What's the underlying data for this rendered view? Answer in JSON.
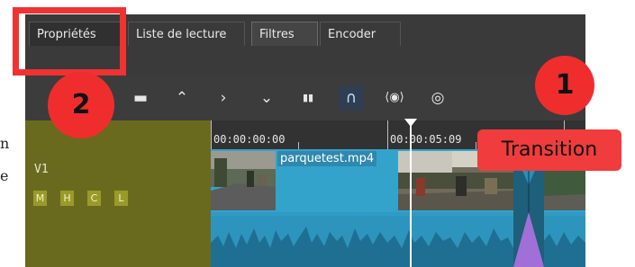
{
  "tabs": {
    "properties": "Propriétés",
    "playlist": "Liste de lecture",
    "filters": "Filtres",
    "encoder": "Encoder"
  },
  "toolbar": {
    "icons": [
      "minus-icon",
      "chevron-up-icon",
      "chevron-right-icon",
      "chevron-down-icon",
      "split-icon",
      "magnet-icon",
      "ripple-icon",
      "record-icon"
    ],
    "glyphs": {
      "minus": "▬",
      "up": "⌃",
      "right": "›",
      "down": "⌄",
      "split": "▮▮",
      "magnet": "∩",
      "ripple": "⟨◉⟩",
      "record": "◎"
    }
  },
  "track": {
    "name": "V1",
    "buttons": [
      "M",
      "H",
      "C",
      "L"
    ]
  },
  "ruler": {
    "tc_start": "00:00:00:00",
    "tc_second": "00:00:05:09"
  },
  "clip": {
    "name": "parquetest.mp4"
  },
  "annotations": {
    "marker_1": "1",
    "marker_2": "2",
    "transition_label": "Transition"
  },
  "edge_text": {
    "line1": "n",
    "line2": "e"
  },
  "colors": {
    "clip": "#2f9bc4",
    "track_header": "#6a6a1e",
    "transition": "#a070d8",
    "annotation": "#f03232"
  }
}
